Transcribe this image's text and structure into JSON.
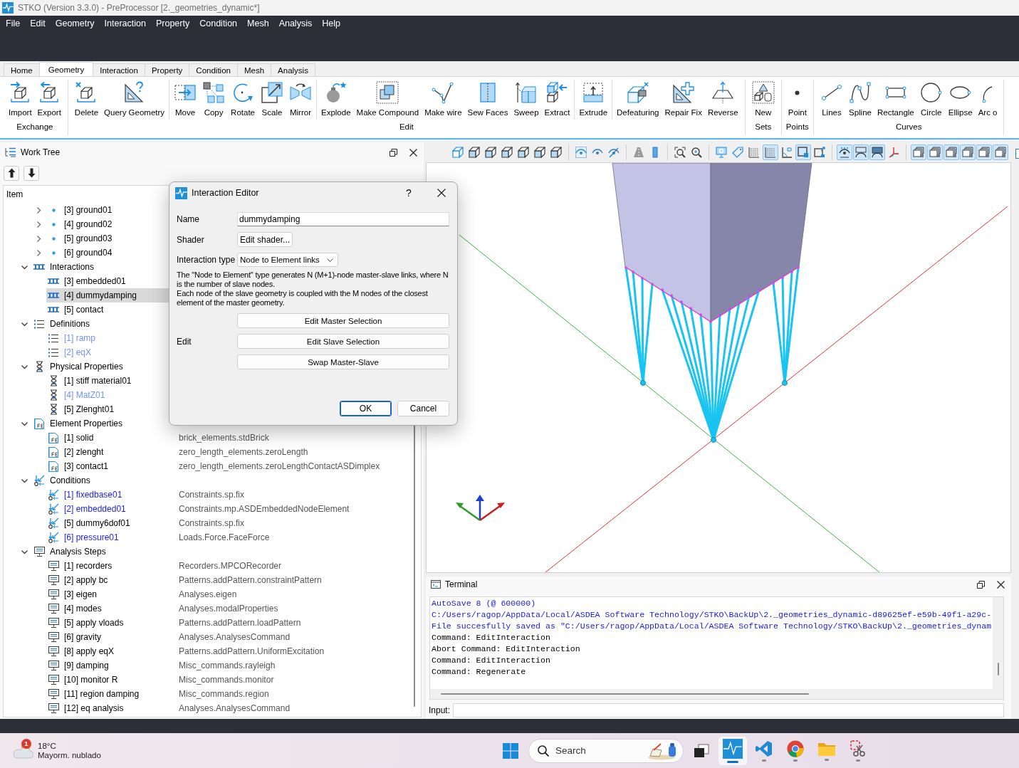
{
  "window": {
    "title": "STKO (Version 3.3.0) - PreProcessor [2._geometries_dynamic*]"
  },
  "menu": [
    "File",
    "Edit",
    "Geometry",
    "Interaction",
    "Property",
    "Condition",
    "Mesh",
    "Analysis",
    "Help"
  ],
  "ribbon_tabs": [
    {
      "label": "Home",
      "selected": false
    },
    {
      "label": "Geometry",
      "selected": true
    },
    {
      "label": "Interaction",
      "selected": false
    },
    {
      "label": "Property",
      "selected": false
    },
    {
      "label": "Condition",
      "selected": false
    },
    {
      "label": "Mesh",
      "selected": false
    },
    {
      "label": "Analysis",
      "selected": false
    }
  ],
  "ribbon_groups": [
    {
      "label": "Exchange",
      "sections": [
        [
          {
            "label": "Import",
            "kind": "import"
          },
          {
            "label": "Export",
            "kind": "export"
          }
        ]
      ]
    },
    {
      "label": "Edit",
      "sections": [
        [
          {
            "label": "Delete",
            "kind": "delete"
          },
          {
            "label": "Query Geometry",
            "kind": "query"
          }
        ],
        [
          {
            "label": "Move",
            "kind": "move"
          },
          {
            "label": "Copy",
            "kind": "copy"
          },
          {
            "label": "Rotate",
            "kind": "rotate"
          },
          {
            "label": "Scale",
            "kind": "scale"
          },
          {
            "label": "Mirror",
            "kind": "mirror"
          }
        ],
        [
          {
            "label": "Explode",
            "kind": "explode"
          },
          {
            "label": "Make Compound",
            "kind": "compound"
          },
          {
            "label": "Make wire",
            "kind": "wire"
          },
          {
            "label": "Sew Faces",
            "kind": "sew"
          },
          {
            "label": "Sweep",
            "kind": "sweep"
          },
          {
            "label": "Extract",
            "kind": "extract"
          }
        ],
        [
          {
            "label": "Extrude",
            "kind": "extrude"
          }
        ],
        [
          {
            "label": "Defeaturing",
            "kind": "defeature"
          },
          {
            "label": "Repair Fix",
            "kind": "repair"
          },
          {
            "label": "Reverse",
            "kind": "reverse"
          }
        ]
      ]
    },
    {
      "label": "Sets",
      "sections": [
        [
          {
            "label": "New",
            "kind": "sets"
          }
        ]
      ]
    },
    {
      "label": "Points",
      "sections": [
        [
          {
            "label": "Point",
            "kind": "point"
          }
        ]
      ]
    },
    {
      "label": "Curves",
      "sections": [
        [
          {
            "label": "Lines",
            "kind": "line"
          },
          {
            "label": "Spline",
            "kind": "spline"
          },
          {
            "label": "Rectangle",
            "kind": "rectangle"
          },
          {
            "label": "Circle",
            "kind": "circle"
          },
          {
            "label": "Ellipse",
            "kind": "ellipse"
          },
          {
            "label": "Arc o",
            "kind": "arc"
          }
        ]
      ]
    }
  ],
  "work_tree": {
    "title": "Work Tree",
    "header": "Item",
    "nodes": [
      {
        "kind": "point",
        "children": [
          {
            "label": "[3] ground01",
            "expanded": false,
            "selected": false
          },
          {
            "label": "[4] ground02",
            "expanded": false,
            "selected": false
          },
          {
            "label": "[5] ground03",
            "expanded": false,
            "selected": false
          },
          {
            "label": "[6] ground04",
            "expanded": false,
            "selected": false
          }
        ]
      },
      {
        "label": "Interactions",
        "kind": "interaction",
        "expanded": true,
        "selected": false,
        "children": [
          {
            "label": "[3] embedded01",
            "selected": false
          },
          {
            "label": "[4] dummydamping",
            "selected": true
          },
          {
            "label": "[5] contact",
            "selected": false
          }
        ]
      },
      {
        "label": "Definitions",
        "kind": "definition",
        "expanded": true,
        "selected": false,
        "children": [
          {
            "label": "[1] ramp",
            "selected": false,
            "color": "#7292f4"
          },
          {
            "label": "[2] eqX",
            "selected": false,
            "color": "#7292f4"
          }
        ]
      },
      {
        "label": "Physical Properties",
        "kind": "physical",
        "expanded": true,
        "selected": false,
        "children": [
          {
            "label": "[1] stiff material01",
            "selected": false
          },
          {
            "label": "[4] MatZ01",
            "selected": false,
            "color": "#7292f4"
          },
          {
            "label": "[5] Zlenght01",
            "selected": false
          }
        ]
      },
      {
        "label": "Element Properties",
        "kind": "element",
        "expanded": true,
        "selected": false,
        "children": [
          {
            "label": "[1] solid",
            "value": "brick_elements.stdBrick",
            "selected": false
          },
          {
            "label": "[2] zlenght",
            "value": "zero_length_elements.zeroLength",
            "selected": false
          },
          {
            "label": "[3] contact1",
            "value": "zero_length_elements.zeroLengthContactASDimplex",
            "selected": false
          }
        ]
      },
      {
        "label": "Conditions",
        "kind": "condition",
        "expanded": true,
        "selected": false,
        "children": [
          {
            "label": "[1] fixedbase01",
            "value": "Constraints.sp.fix",
            "selected": false,
            "color": "#1c1cf0"
          },
          {
            "label": "[2] embedded01",
            "value": "Constraints.mp.ASDEmbeddedNodeElement",
            "selected": false,
            "color": "#1c1cf0"
          },
          {
            "label": "[5] dummy6dof01",
            "value": "Constraints.sp.fix",
            "selected": false
          },
          {
            "label": "[6] pressure01",
            "value": "Loads.Force.FaceForce",
            "selected": false,
            "color": "#1c1cf0"
          }
        ]
      },
      {
        "label": "Analysis Steps",
        "kind": "analysis",
        "expanded": true,
        "selected": false,
        "children": [
          {
            "label": "[1] recorders",
            "value": "Recorders.MPCORecorder",
            "selected": false
          },
          {
            "label": "[2] apply bc",
            "value": "Patterns.addPattern.constraintPattern",
            "selected": false
          },
          {
            "label": "[3] eigen",
            "value": "Analyses.eigen",
            "selected": false
          },
          {
            "label": "[4] modes",
            "value": "Analyses.modalProperties",
            "selected": false
          },
          {
            "label": "[5] apply vloads",
            "value": "Patterns.addPattern.loadPattern",
            "selected": false
          },
          {
            "label": "[6] gravity",
            "value": "Analyses.AnalysesCommand",
            "selected": false
          },
          {
            "label": "[8] apply eqX",
            "value": "Patterns.addPattern.UniformExcitation",
            "selected": false
          },
          {
            "label": "[9] damping",
            "value": "Misc_commands.rayleigh",
            "selected": false
          },
          {
            "label": "[10] monitor R",
            "value": "Misc_commands.monitor",
            "selected": false
          },
          {
            "label": "[11] region damping",
            "value": "Misc_commands.region",
            "selected": false
          },
          {
            "label": "[12] eq analysis",
            "value": "Analyses.AnalysesCommand",
            "selected": false
          }
        ]
      }
    ]
  },
  "view_toolbar": [
    {
      "buttons": [
        {
          "kind": "cube-iso",
          "on": false
        },
        {
          "kind": "cube",
          "on": false
        },
        {
          "kind": "cube",
          "on": false
        },
        {
          "kind": "cube",
          "on": false
        },
        {
          "kind": "cube",
          "on": false
        },
        {
          "kind": "cube",
          "on": false
        },
        {
          "kind": "cube",
          "on": false
        }
      ]
    },
    {
      "buttons": [
        {
          "kind": "eye-dotted",
          "on": false
        },
        {
          "kind": "eye",
          "on": false
        },
        {
          "kind": "eye-off",
          "on": false
        }
      ]
    },
    {
      "buttons": [
        {
          "kind": "perspective",
          "on": false
        },
        {
          "kind": "column",
          "on": false
        }
      ]
    },
    {
      "buttons": [
        {
          "kind": "zoom-fit",
          "on": false
        },
        {
          "kind": "zoom",
          "on": false
        }
      ]
    },
    {
      "buttons": [
        {
          "kind": "monitor",
          "on": false
        },
        {
          "kind": "tag",
          "on": false
        },
        {
          "kind": "grid",
          "on": false
        },
        {
          "kind": "grid",
          "on": true
        },
        {
          "kind": "angle",
          "on": false
        },
        {
          "kind": "frame",
          "on": true
        },
        {
          "kind": "frame-arrow",
          "on": false
        }
      ]
    },
    {
      "buttons": [
        {
          "kind": "view-dots",
          "on": true
        },
        {
          "kind": "view-arc",
          "on": true
        },
        {
          "kind": "view-fill",
          "on": true
        },
        {
          "kind": "axes",
          "on": false
        }
      ]
    },
    {
      "buttons": [
        {
          "kind": "layer",
          "on": true
        },
        {
          "kind": "layer",
          "on": true
        },
        {
          "kind": "layer",
          "on": true
        },
        {
          "kind": "layer",
          "on": true
        },
        {
          "kind": "layer",
          "on": true
        },
        {
          "kind": "layer",
          "on": true
        }
      ]
    }
  ],
  "terminal": {
    "title": "Terminal",
    "lines": [
      {
        "kind": "info",
        "text": "AutoSave 8 (@ 600000)"
      },
      {
        "kind": "info",
        "text": "C:/Users/ragop/AppData/Local/ASDEA Software Technology/STKO\\BackUp\\2._geometries_dynamic-d89625ef-e59b-49f1-a29c-"
      },
      {
        "kind": "info",
        "text": "File succesfully saved as \"C:/Users/ragop/AppData/Local/ASDEA Software Technology/STKO\\BackUp\\2._geometries_dynam"
      },
      {
        "kind": "command",
        "text": "Command: EditInteraction"
      },
      {
        "kind": "command",
        "text": "Abort Command: EditInteraction"
      },
      {
        "kind": "command",
        "text": "Command: EditInteraction"
      },
      {
        "kind": "command",
        "text": "Command: Regenerate"
      }
    ],
    "input_label": "Input:"
  },
  "dialog": {
    "title": "Interaction Editor",
    "help": "?",
    "fields": [
      {
        "label": "Name",
        "kind": "text",
        "value": "dummydamping"
      },
      {
        "label": "Shader",
        "kind": "button",
        "value": "Edit shader..."
      },
      {
        "label": "Interaction type",
        "kind": "select",
        "value": "Node to Element links"
      }
    ],
    "description": [
      "The \"Node to Element\" type generates N (M+1)-node master-slave links, where N is the number of slave nodes.",
      "Each node of the slave geometry is coupled with the M nodes of the closest element of the master geometry."
    ],
    "edit_label": "Edit",
    "edit_buttons": [
      "Edit Master Selection",
      "Edit Slave Selection",
      "Swap Master-Slave"
    ],
    "buttons": [
      {
        "label": "OK",
        "default": true
      },
      {
        "label": "Cancel",
        "default": false
      }
    ]
  },
  "taskbar": {
    "weather": {
      "badge": "1",
      "temperature": "18°C",
      "condition": "Mayorm. nublado"
    },
    "search": {
      "label": "Search"
    },
    "apps": [
      {
        "kind": "start",
        "selected": false
      },
      {
        "kind": "task-view",
        "selected": false
      },
      {
        "kind": "stko",
        "running": true,
        "selected": true
      },
      {
        "kind": "code-editor",
        "running": true,
        "selected": false
      },
      {
        "kind": "browser",
        "running": true,
        "selected": false
      },
      {
        "kind": "folder",
        "running": true,
        "selected": false
      },
      {
        "kind": "snipping",
        "running": true,
        "selected": false
      }
    ]
  }
}
